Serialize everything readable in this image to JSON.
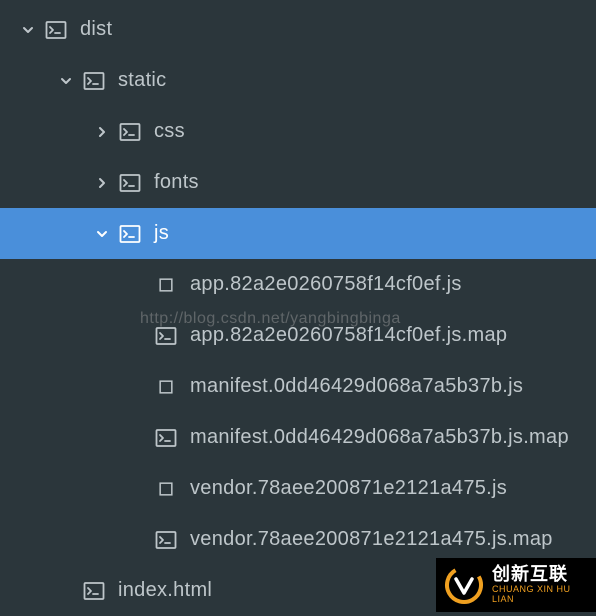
{
  "tree": {
    "root": {
      "label": "dist"
    },
    "static": {
      "label": "static"
    },
    "css": {
      "label": "css"
    },
    "fonts": {
      "label": "fonts"
    },
    "js": {
      "label": "js"
    },
    "files": [
      {
        "label": "app.82a2e0260758f14cf0ef.js",
        "icon": "square"
      },
      {
        "label": "app.82a2e0260758f14cf0ef.js.map",
        "icon": "terminal"
      },
      {
        "label": "manifest.0dd46429d068a7a5b37b.js",
        "icon": "square"
      },
      {
        "label": "manifest.0dd46429d068a7a5b37b.js.map",
        "icon": "terminal"
      },
      {
        "label": "vendor.78aee200871e2121a475.js",
        "icon": "square"
      },
      {
        "label": "vendor.78aee200871e2121a475.js.map",
        "icon": "terminal"
      }
    ],
    "index": {
      "label": "index.html"
    }
  },
  "watermark": "http://blog.csdn.net/yangbingbinga",
  "logo": {
    "main": "创新互联",
    "sub": "CHUANG XIN HU LIAN"
  },
  "colors": {
    "selected": "#4a8fda",
    "bg": "#2b363b",
    "text": "#bec6ca"
  }
}
